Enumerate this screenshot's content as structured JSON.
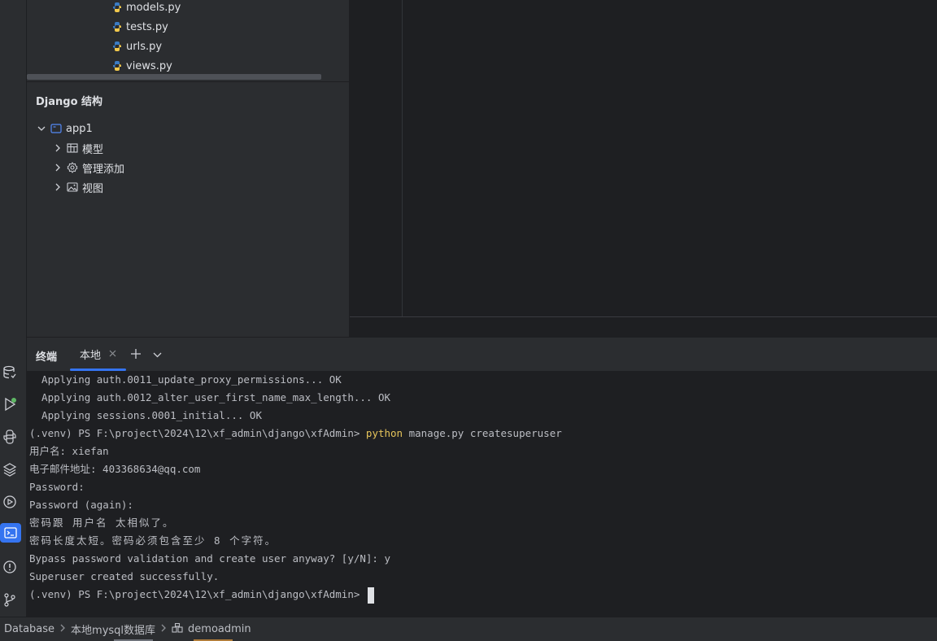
{
  "project": {
    "files": [
      "models.py",
      "tests.py",
      "urls.py",
      "views.py"
    ]
  },
  "structure": {
    "title": "Django 结构",
    "app": "app1",
    "nodes": [
      "模型",
      "管理添加",
      "视图"
    ]
  },
  "terminal": {
    "title": "终端",
    "tab_label": "本地",
    "prompt": "(.venv) PS F:\\project\\2024\\12\\xf_admin\\django\\xfAdmin> ",
    "command_keyword": "python",
    "command_rest": " manage.py createsuperuser",
    "lines": [
      "  Applying auth.0011_update_proxy_permissions... OK",
      "  Applying auth.0012_alter_user_first_name_max_length... OK",
      "  Applying sessions.0001_initial... OK"
    ],
    "output": [
      "用户名: xiefan",
      "电子邮件地址: 403368634@qq.com",
      "Password:",
      "Password (again):",
      "密码跟 用户名 太相似了。",
      "密码长度太短。密码必须包含至少 8 个字符。",
      "Bypass password validation and create user anyway? [y/N]: y",
      "Superuser created successfully."
    ]
  },
  "statusbar": {
    "crumbs": [
      "Database",
      "本地mysql数据库",
      "demoadmin"
    ]
  },
  "colors": {
    "accent": "#3574f0",
    "command": "#e6c45b",
    "background": "#1e1f22",
    "panel": "#2b2d30"
  },
  "icons": [
    "database-icon",
    "run-icon",
    "python-console-icon",
    "layers-icon",
    "services-icon",
    "terminal-icon",
    "problems-icon",
    "git-icon"
  ]
}
